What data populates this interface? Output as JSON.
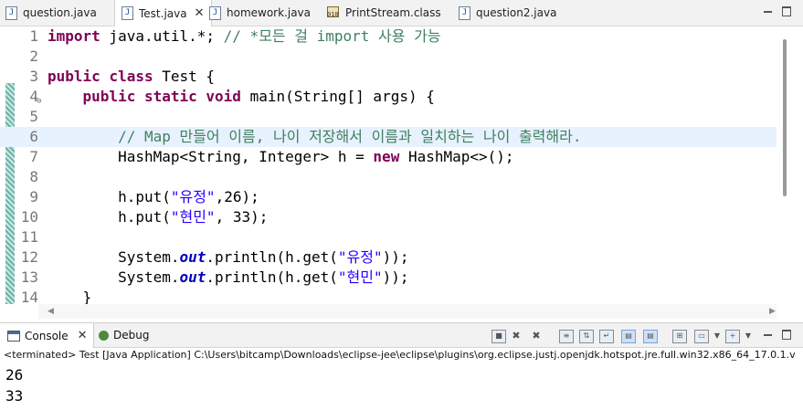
{
  "tabs": [
    {
      "label": "question.java",
      "icon": "java-file-icon",
      "active": false
    },
    {
      "label": "Test.java",
      "icon": "java-file-icon",
      "active": true,
      "close": "✕"
    },
    {
      "label": "homework.java",
      "icon": "java-file-icon",
      "active": false
    },
    {
      "label": "PrintStream.class",
      "icon": "class-file-icon",
      "active": false
    },
    {
      "label": "question2.java",
      "icon": "java-file-icon",
      "active": false
    }
  ],
  "editor": {
    "line_numbers": [
      "1",
      "2",
      "3",
      "4",
      "5",
      "6",
      "7",
      "8",
      "9",
      "10",
      "11",
      "12",
      "13",
      "14"
    ],
    "fold_marker": "⊖",
    "current_line": 6,
    "lines": [
      [
        {
          "t": "import",
          "c": "kw"
        },
        {
          "t": " java.util.*; "
        },
        {
          "t": "// *모든 걸 import 사용 가능",
          "c": "cm"
        }
      ],
      [],
      [
        {
          "t": "public",
          "c": "kw"
        },
        {
          "t": " "
        },
        {
          "t": "class",
          "c": "kw"
        },
        {
          "t": " Test {"
        }
      ],
      [
        {
          "t": "    "
        },
        {
          "t": "public",
          "c": "kw"
        },
        {
          "t": " "
        },
        {
          "t": "static",
          "c": "kw"
        },
        {
          "t": " "
        },
        {
          "t": "void",
          "c": "kw"
        },
        {
          "t": " main(String[] args) {"
        }
      ],
      [],
      [
        {
          "t": "        "
        },
        {
          "t": "// Map 만들어 이름, 나이 저장해서 이름과 일치하는 나이 출력해라.",
          "c": "cm"
        }
      ],
      [
        {
          "t": "        HashMap<String, Integer> h = "
        },
        {
          "t": "new",
          "c": "kw"
        },
        {
          "t": " HashMap<>();"
        }
      ],
      [],
      [
        {
          "t": "        h.put("
        },
        {
          "t": "\"유정\"",
          "c": "str"
        },
        {
          "t": ",26);"
        }
      ],
      [
        {
          "t": "        h.put("
        },
        {
          "t": "\"현민\"",
          "c": "str"
        },
        {
          "t": ", 33);"
        }
      ],
      [],
      [
        {
          "t": "        System."
        },
        {
          "t": "out",
          "c": "fld"
        },
        {
          "t": ".println(h.get("
        },
        {
          "t": "\"유정\"",
          "c": "str"
        },
        {
          "t": "));"
        }
      ],
      [
        {
          "t": "        System."
        },
        {
          "t": "out",
          "c": "fld"
        },
        {
          "t": ".println(h.get("
        },
        {
          "t": "\"현민\"",
          "c": "str"
        },
        {
          "t": "));"
        }
      ],
      [
        {
          "t": "    }"
        }
      ]
    ]
  },
  "console": {
    "tabs": [
      {
        "label": "Console",
        "close": "✕"
      },
      {
        "label": "Debug"
      }
    ],
    "status": "<terminated> Test [Java Application] C:\\Users\\bitcamp\\Downloads\\eclipse-jee\\eclipse\\plugins\\org.eclipse.justj.openjdk.hotspot.jre.full.win32.x86_64_17.0.1.v",
    "output": [
      "26",
      "33"
    ]
  },
  "colors": {
    "keyword": "#7f0055",
    "comment": "#3f7f5f",
    "string": "#2a00ff",
    "field": "#0000c0",
    "current_line": "#e8f2fe"
  }
}
